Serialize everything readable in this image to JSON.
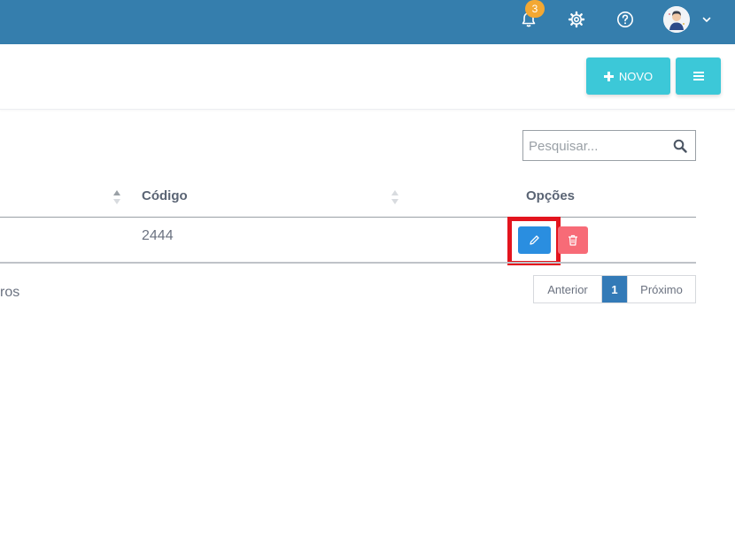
{
  "topbar": {
    "notification_count": "3",
    "icons": [
      "bell-icon",
      "gear-icon",
      "help-icon",
      "chevron-down-icon"
    ]
  },
  "toolbar": {
    "new_label": "NOVO",
    "new_icon": "plus-icon",
    "menu_icon": "hamburger-icon"
  },
  "search": {
    "placeholder": "Pesquisar..."
  },
  "table": {
    "columns": [
      "Código",
      "Opções"
    ],
    "rows": [
      {
        "codigo": "2444"
      }
    ],
    "row_actions": [
      "edit-icon",
      "trash-icon"
    ]
  },
  "footer": {
    "info_fragment": "ros"
  },
  "pagination": {
    "prev_label": "Anterior",
    "current_page": "1",
    "next_label": "Próximo"
  },
  "colors": {
    "topbar": "#357ead",
    "accent": "#3cc8d8",
    "edit": "#2a8ee0",
    "delete": "#f76b77",
    "highlight": "#e3141e",
    "active_page": "#337ab7",
    "badge": "#f3a833"
  }
}
